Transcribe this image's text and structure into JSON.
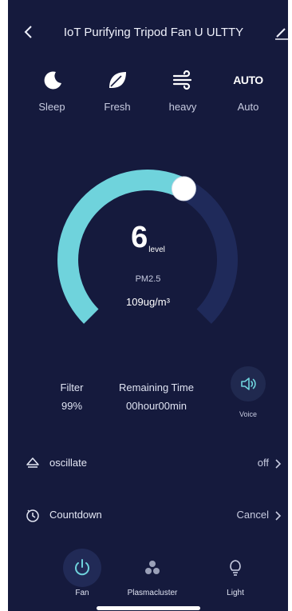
{
  "header": {
    "title": "IoT Purifying Tripod Fan U ULTTY"
  },
  "modes": [
    {
      "label": "Sleep",
      "icon": "moon-icon"
    },
    {
      "label": "Fresh",
      "icon": "leaf-icon"
    },
    {
      "label": "heavy",
      "icon": "wind-icon"
    },
    {
      "label": "Auto",
      "icon": "auto-icon",
      "icon_text": "AUTO"
    }
  ],
  "dial": {
    "level": "6",
    "level_unit": "level",
    "level_fraction": 0.6,
    "pm_label": "PM2.5",
    "pm_value": "109ug/m³"
  },
  "stats": {
    "filter_label": "Filter",
    "filter_value": "99%",
    "remaining_label": "Remaining Time",
    "remaining_value": "00hour00min",
    "voice_label": "Voice"
  },
  "settings": {
    "oscillate": {
      "label": "oscillate",
      "value": "off"
    },
    "countdown": {
      "label": "Countdown",
      "value": "Cancel"
    }
  },
  "tabs": [
    {
      "label": "Fan",
      "icon": "power-icon",
      "active": true
    },
    {
      "label": "Plasmacluster",
      "icon": "plasmacluster-icon",
      "active": false
    },
    {
      "label": "Light",
      "icon": "bulb-icon",
      "active": false
    }
  ],
  "colors": {
    "background": "#151a3d",
    "accent": "#6fd3dc",
    "track": "#1f2a5a"
  }
}
